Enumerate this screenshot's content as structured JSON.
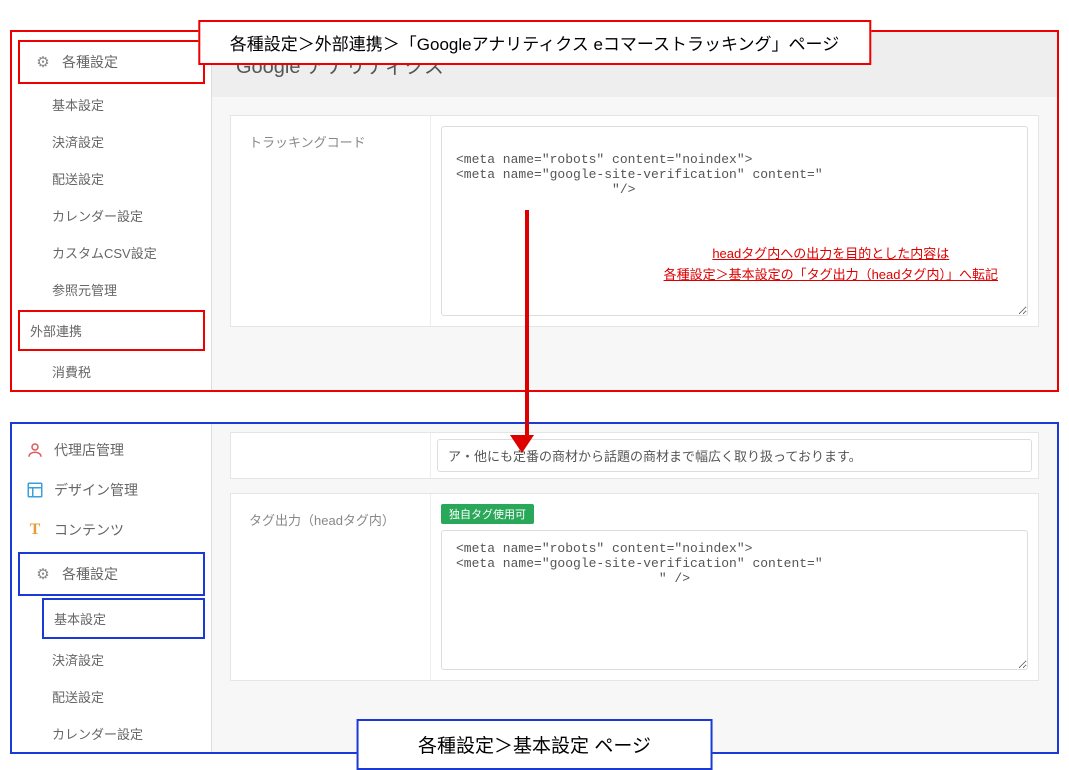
{
  "callouts": {
    "top": "各種設定＞外部連携＞「Googleアナリティクス eコマーストラッキング」ページ",
    "bottom": "各種設定＞基本設定 ページ"
  },
  "top_panel": {
    "sidebar": {
      "section_active": "各種設定",
      "items": [
        "基本設定",
        "決済設定",
        "配送設定",
        "カレンダー設定",
        "カスタムCSV設定",
        "参照元管理",
        "外部連携",
        "消費税"
      ]
    },
    "page_title": "Google アナリティクス",
    "tracking_code": {
      "label": "トラッキングコード",
      "value": "\n<meta name=\"robots\" content=\"noindex\">\n<meta name=\"google-site-verification\" content=\"\n                    \"/>"
    },
    "note_line1": "headタグ内への出力を目的とした内容は",
    "note_line2": "各種設定＞基本設定の「タグ出力（headタグ内）」へ転記"
  },
  "bottom_panel": {
    "sidebar": {
      "sections": [
        {
          "icon": "user",
          "label": "代理店管理",
          "color": "#e0575b"
        },
        {
          "icon": "layout",
          "label": "デザイン管理",
          "color": "#3aa0d8"
        },
        {
          "icon": "T",
          "label": "コンテンツ",
          "color": "#e89b3b"
        }
      ],
      "section_active": "各種設定",
      "sub_active": "基本設定",
      "items": [
        "決済設定",
        "配送設定",
        "カレンダー設定"
      ]
    },
    "prev_text": "ア・他にも定番の商材から話題の商材まで幅広く取り扱っております。",
    "tag_output": {
      "label": "タグ出力（headタグ内）",
      "badge": "独自タグ使用可",
      "value": "<meta name=\"robots\" content=\"noindex\">\n<meta name=\"google-site-verification\" content=\"\n                          \" />"
    }
  }
}
